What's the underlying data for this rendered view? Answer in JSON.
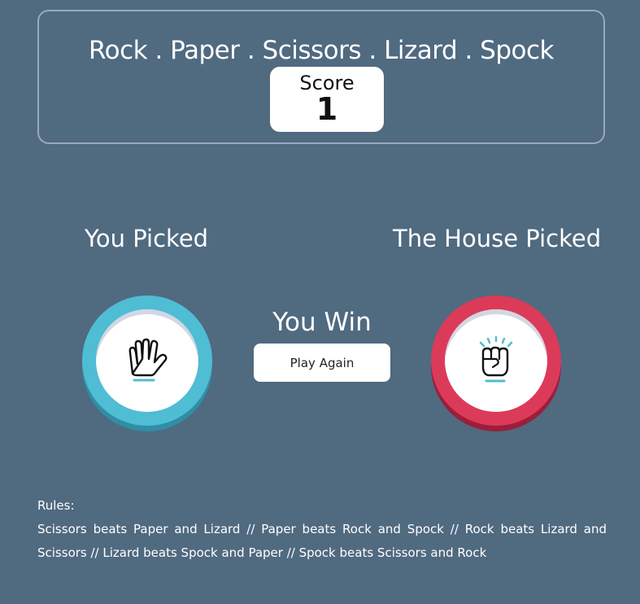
{
  "header": {
    "title": "Rock . Paper . Scissors . Lizard . Spock",
    "score_label": "Score",
    "score_value": "1"
  },
  "game": {
    "you_picked_label": "You Picked",
    "house_picked_label": "The House Picked",
    "you_choice_icon": "spock-hand-icon",
    "house_choice_icon": "rock-fist-icon",
    "result_text": "You Win",
    "play_again_label": "Play Again"
  },
  "rules": {
    "title": "Rules:",
    "text": "Scissors beats Paper and Lizard // Paper beats Rock and Spock // Rock beats Lizard and Scissors // Lizard beats Spock and Paper // Spock beats Scissors and Rock"
  },
  "colors": {
    "background": "#506a80",
    "spock_ring": "#4fbdd4",
    "rock_ring": "#dc3a59",
    "header_border": "#9aa7c4",
    "accent_line": "#4fbdd4"
  }
}
